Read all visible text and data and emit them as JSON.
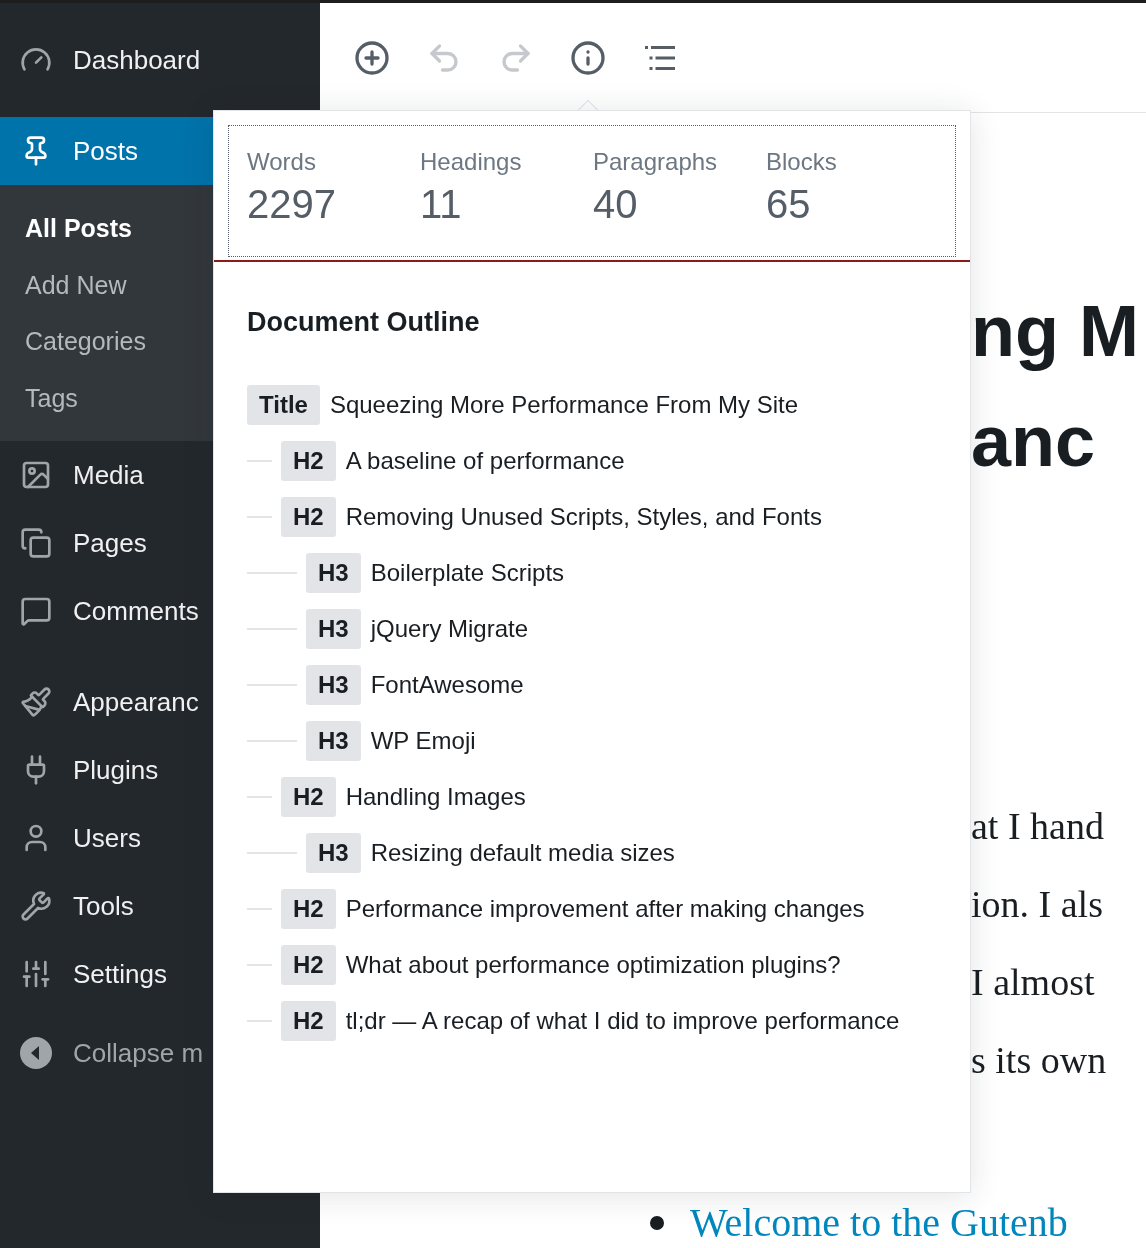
{
  "sidebar": {
    "groups": [
      {
        "items": [
          {
            "label": "Dashboard",
            "selected": false
          }
        ]
      },
      {
        "items": [
          {
            "label": "Posts",
            "selected": true,
            "children": [
              {
                "label": "All Posts",
                "selected": true
              },
              {
                "label": "Add New",
                "selected": false
              },
              {
                "label": "Categories",
                "selected": false
              },
              {
                "label": "Tags",
                "selected": false
              }
            ]
          },
          {
            "label": "Media",
            "selected": false
          },
          {
            "label": "Pages",
            "selected": false
          },
          {
            "label": "Comments",
            "selected": false
          }
        ]
      },
      {
        "items": [
          {
            "label": "Appearanc",
            "selected": false
          },
          {
            "label": "Plugins",
            "selected": false
          },
          {
            "label": "Users",
            "selected": false
          },
          {
            "label": "Tools",
            "selected": false
          },
          {
            "label": "Settings",
            "selected": false
          }
        ]
      }
    ],
    "collapse": {
      "label": "Collapse m"
    }
  },
  "toolbar": {
    "tools": [
      {
        "disabled": false
      },
      {
        "disabled": true
      },
      {
        "disabled": true
      },
      {
        "disabled": false
      },
      {
        "disabled": false
      }
    ]
  },
  "editor": {
    "title_lines": [
      "ng M",
      "anc"
    ],
    "paragraph_lines": [
      "at I hand",
      "ion. I als",
      "I almost",
      "s its own"
    ],
    "list_items": [
      "Welcome to the Gutenb"
    ]
  },
  "info_popover": {
    "stats": [
      {
        "label": "Words",
        "value": "2297"
      },
      {
        "label": "Headings",
        "value": "11"
      },
      {
        "label": "Paragraphs",
        "value": "40"
      },
      {
        "label": "Blocks",
        "value": "65"
      }
    ],
    "outline": {
      "heading": "Document Outline",
      "title_badge": "Title",
      "title": "Squeezing More Performance From My Site",
      "items": [
        {
          "level": "H2",
          "text": "A baseline of performance"
        },
        {
          "level": "H2",
          "text": "Removing Unused Scripts, Styles, and Fonts",
          "children": [
            {
              "level": "H3",
              "text": "Boilerplate Scripts"
            },
            {
              "level": "H3",
              "text": "jQuery Migrate"
            },
            {
              "level": "H3",
              "text": "FontAwesome"
            },
            {
              "level": "H3",
              "text": "WP Emoji"
            }
          ]
        },
        {
          "level": "H2",
          "text": "Handling Images",
          "children": [
            {
              "level": "H3",
              "text": "Resizing default media sizes"
            }
          ]
        },
        {
          "level": "H2",
          "text": "Performance improvement after making changes"
        },
        {
          "level": "H2",
          "text": "What about performance optimization plugins?"
        },
        {
          "level": "H2",
          "text": "tl;dr — A recap of what I did to improve performance"
        }
      ]
    }
  }
}
